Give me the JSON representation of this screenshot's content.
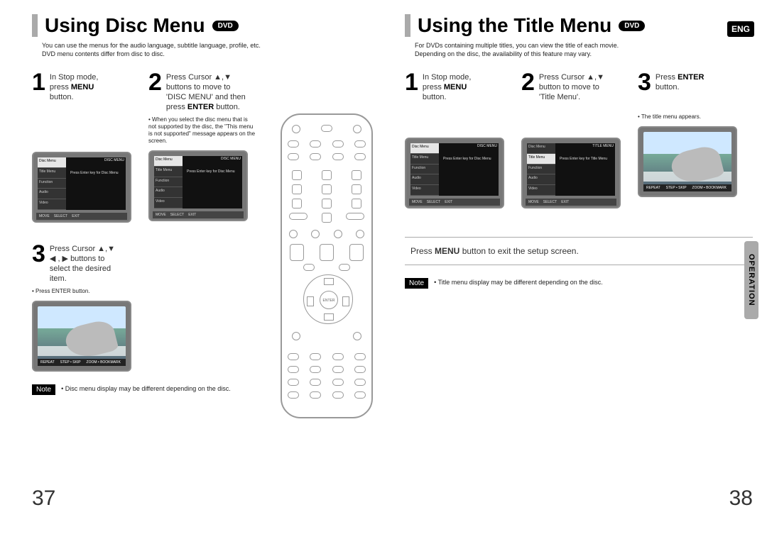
{
  "lang_badge": "ENG",
  "side_tab": "OPERATION",
  "dvd_label": "DVD",
  "left": {
    "title": "Using Disc Menu",
    "intro": "You can use the menus for the audio language, subtitle language, profile, etc.\nDVD menu contents differ from disc to disc.",
    "step1": {
      "num": "1",
      "lines": [
        "In Stop mode,",
        "press ",
        "MENU",
        "button."
      ]
    },
    "step2": {
      "num": "2",
      "lead": "Press Cursor ▲,▼",
      "l2": "buttons to move to",
      "l3": "'DISC MENU' and then",
      "l4a": "press ",
      "l4b": "ENTER",
      "l4c": " button.",
      "note": "When you select the disc menu that is not supported by the disc, the \"This menu is not supported\" message appears on the screen."
    },
    "step3": {
      "num": "3",
      "lead": "Press Cursor ▲,▼",
      "l2": "◀ , ▶ buttons to",
      "l3": "select the desired",
      "l4": "item.",
      "note": "Press ENTER button."
    },
    "note": "Disc menu display may be different depending on the disc.",
    "page_num": "37",
    "tv_menu": {
      "tabs": [
        "Function",
        "Title Menu",
        "Audio",
        "Video"
      ],
      "active_label": "Disc Menu",
      "header": "DISC MENU",
      "msg": "Press Enter key for Disc Menu",
      "legend": [
        "MOVE",
        "SELECT",
        "EXIT"
      ]
    },
    "tv_photo_bar": [
      "REPEAT",
      "STEP • SKIP",
      "ZOOM • BOOKMARK"
    ]
  },
  "right": {
    "title": "Using the Title Menu",
    "intro": "For DVDs containing multiple titles, you can view the title of each movie.\nDepending on the disc, the availability of this feature may vary.",
    "step1": {
      "num": "1",
      "lines": [
        "In Stop mode,",
        "press ",
        "MENU",
        "button."
      ]
    },
    "step2": {
      "num": "2",
      "lead": "Press Cursor ▲,▼",
      "l2": "button to move to",
      "l3": "'Title Menu'."
    },
    "step3": {
      "num": "3",
      "l1a": "Press ",
      "l1b": "ENTER",
      "l2": "button.",
      "note": "The title menu appears."
    },
    "callout_a": "Press ",
    "callout_b": "MENU",
    "callout_c": " button to exit the setup screen.",
    "note": "Title menu display may be different depending on the disc.",
    "page_num": "38",
    "tv_menu": {
      "tabs": [
        "Function",
        "Title Menu",
        "Audio",
        "Video"
      ],
      "active_label": "Disc Menu",
      "header": "TITLE MENU",
      "msg": "Press Enter key for Title Menu",
      "legend": [
        "MOVE",
        "SELECT",
        "EXIT"
      ]
    },
    "tv_photo_bar": [
      "REPEAT",
      "STEP • SKIP",
      "ZOOM • BOOKMARK"
    ]
  },
  "note_label": "Note",
  "remote_center": "ENTER"
}
